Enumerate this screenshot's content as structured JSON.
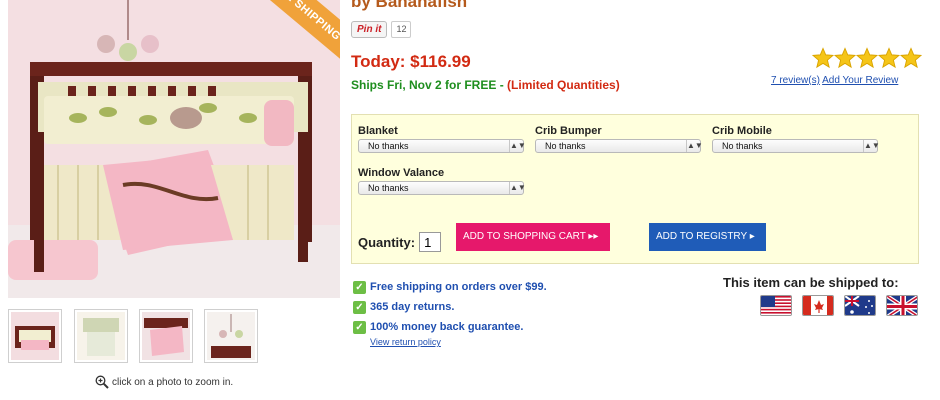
{
  "product": {
    "brand_line": "by Bananafish",
    "ribbon_text": "FREE SHIPPING",
    "pin_label": "Pin it",
    "pin_count": "12",
    "price": "Today: $116.99",
    "ships_text": "Ships Fri, Nov 2 for FREE - ",
    "ships_limited": "(Limited Quantities)",
    "rating_stars": 5,
    "reviews_link": "7 review(s)",
    "add_review_link": "Add Your Review"
  },
  "options": {
    "blanket": {
      "label": "Blanket",
      "value": "No thanks"
    },
    "crib_bumper": {
      "label": "Crib Bumper",
      "value": "No thanks"
    },
    "crib_mobile": {
      "label": "Crib Mobile",
      "value": "No thanks"
    },
    "window_valance": {
      "label": "Window Valance",
      "value": "No thanks"
    },
    "select_arrows": "▲▼"
  },
  "purchase": {
    "quantity_label": "Quantity:",
    "quantity_value": "1",
    "add_to_cart": "ADD TO SHOPPING CART ▸▸",
    "add_to_registry": "ADD TO REGISTRY ▸"
  },
  "benefits": [
    "Free shipping on orders over $99.",
    "365 day returns.",
    "100% money back guarantee."
  ],
  "return_policy_link": "View return policy",
  "shipping": {
    "heading": "This item can be shipped to:",
    "flags": [
      "us-flag",
      "canada-flag",
      "australia-flag",
      "uk-flag"
    ]
  },
  "gallery": {
    "zoom_hint": "click on a photo to zoom in."
  },
  "colors": {
    "price_red": "#d22a12",
    "ships_green": "#1e8e1e",
    "cart_pink": "#e6186b",
    "registry_blue": "#1f5cb8",
    "options_bg": "#ffffdd",
    "star_gold": "#f5c518"
  }
}
